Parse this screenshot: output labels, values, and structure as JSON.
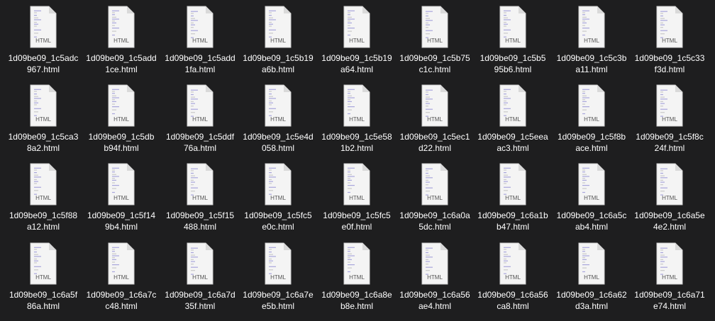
{
  "file_type_label": "HTML",
  "icon": "html-document-icon",
  "files": [
    {
      "name": "1d09be09_1c5adc967.html",
      "line1": "1d09be09_1c5adc",
      "line2": "967.html"
    },
    {
      "name": "1d09be09_1c5add1ce.html",
      "line1": "1d09be09_1c5add",
      "line2": "1ce.html"
    },
    {
      "name": "1d09be09_1c5add1fa.html",
      "line1": "1d09be09_1c5add",
      "line2": "1fa.html"
    },
    {
      "name": "1d09be09_1c5b19a6b.html",
      "line1": "1d09be09_1c5b19",
      "line2": "a6b.html"
    },
    {
      "name": "1d09be09_1c5b19a64.html",
      "line1": "1d09be09_1c5b19",
      "line2": "a64.html"
    },
    {
      "name": "1d09be09_1c5b75c1c.html",
      "line1": "1d09be09_1c5b75",
      "line2": "c1c.html"
    },
    {
      "name": "1d09be09_1c5b595b6.html",
      "line1": "1d09be09_1c5b5",
      "line2": "95b6.html"
    },
    {
      "name": "1d09be09_1c5c3ba11.html",
      "line1": "1d09be09_1c5c3b",
      "line2": "a11.html"
    },
    {
      "name": "1d09be09_1c5c33f3d.html",
      "line1": "1d09be09_1c5c33",
      "line2": "f3d.html"
    },
    {
      "name": "1d09be09_1c5ca38a2.html",
      "line1": "1d09be09_1c5ca3",
      "line2": "8a2.html"
    },
    {
      "name": "1d09be09_1c5dbb94f.html",
      "line1": "1d09be09_1c5db",
      "line2": "b94f.html"
    },
    {
      "name": "1d09be09_1c5ddf76a.html",
      "line1": "1d09be09_1c5ddf",
      "line2": "76a.html"
    },
    {
      "name": "1d09be09_1c5e4d058.html",
      "line1": "1d09be09_1c5e4d",
      "line2": "058.html"
    },
    {
      "name": "1d09be09_1c5e581b2.html",
      "line1": "1d09be09_1c5e58",
      "line2": "1b2.html"
    },
    {
      "name": "1d09be09_1c5ec1d22.html",
      "line1": "1d09be09_1c5ec1",
      "line2": "d22.html"
    },
    {
      "name": "1d09be09_1c5eeaac3.html",
      "line1": "1d09be09_1c5eea",
      "line2": "ac3.html"
    },
    {
      "name": "1d09be09_1c5f8bace.html",
      "line1": "1d09be09_1c5f8b",
      "line2": "ace.html"
    },
    {
      "name": "1d09be09_1c5f8c24f.html",
      "line1": "1d09be09_1c5f8c",
      "line2": "24f.html"
    },
    {
      "name": "1d09be09_1c5f88a12.html",
      "line1": "1d09be09_1c5f88",
      "line2": "a12.html"
    },
    {
      "name": "1d09be09_1c5f149b4.html",
      "line1": "1d09be09_1c5f14",
      "line2": "9b4.html"
    },
    {
      "name": "1d09be09_1c5f15488.html",
      "line1": "1d09be09_1c5f15",
      "line2": "488.html"
    },
    {
      "name": "1d09be09_1c5fc5e0c.html",
      "line1": "1d09be09_1c5fc5",
      "line2": "e0c.html"
    },
    {
      "name": "1d09be09_1c5fc5e0f.html",
      "line1": "1d09be09_1c5fc5",
      "line2": "e0f.html"
    },
    {
      "name": "1d09be09_1c6a0a5dc.html",
      "line1": "1d09be09_1c6a0a",
      "line2": "5dc.html"
    },
    {
      "name": "1d09be09_1c6a1bb47.html",
      "line1": "1d09be09_1c6a1b",
      "line2": "b47.html"
    },
    {
      "name": "1d09be09_1c6a5cab4.html",
      "line1": "1d09be09_1c6a5c",
      "line2": "ab4.html"
    },
    {
      "name": "1d09be09_1c6a5e4e2.html",
      "line1": "1d09be09_1c6a5e",
      "line2": "4e2.html"
    },
    {
      "name": "1d09be09_1c6a5f86a.html",
      "line1": "1d09be09_1c6a5f",
      "line2": "86a.html"
    },
    {
      "name": "1d09be09_1c6a7cc48.html",
      "line1": "1d09be09_1c6a7c",
      "line2": "c48.html"
    },
    {
      "name": "1d09be09_1c6a7d35f.html",
      "line1": "1d09be09_1c6a7d",
      "line2": "35f.html"
    },
    {
      "name": "1d09be09_1c6a7ee5b.html",
      "line1": "1d09be09_1c6a7e",
      "line2": "e5b.html"
    },
    {
      "name": "1d09be09_1c6a8eb8e.html",
      "line1": "1d09be09_1c6a8e",
      "line2": "b8e.html"
    },
    {
      "name": "1d09be09_1c6a56ae4.html",
      "line1": "1d09be09_1c6a56",
      "line2": "ae4.html"
    },
    {
      "name": "1d09be09_1c6a56ca8.html",
      "line1": "1d09be09_1c6a56",
      "line2": "ca8.html"
    },
    {
      "name": "1d09be09_1c6a62d3a.html",
      "line1": "1d09be09_1c6a62",
      "line2": "d3a.html"
    },
    {
      "name": "1d09be09_1c6a71e74.html",
      "line1": "1d09be09_1c6a71",
      "line2": "e74.html"
    }
  ],
  "colors": {
    "background": "#1e1e1f",
    "text": "#ffffff",
    "icon_paper": "#f4f4f4",
    "icon_fold": "#d9d9d9",
    "thumb_accent": "#a9a6dc"
  }
}
